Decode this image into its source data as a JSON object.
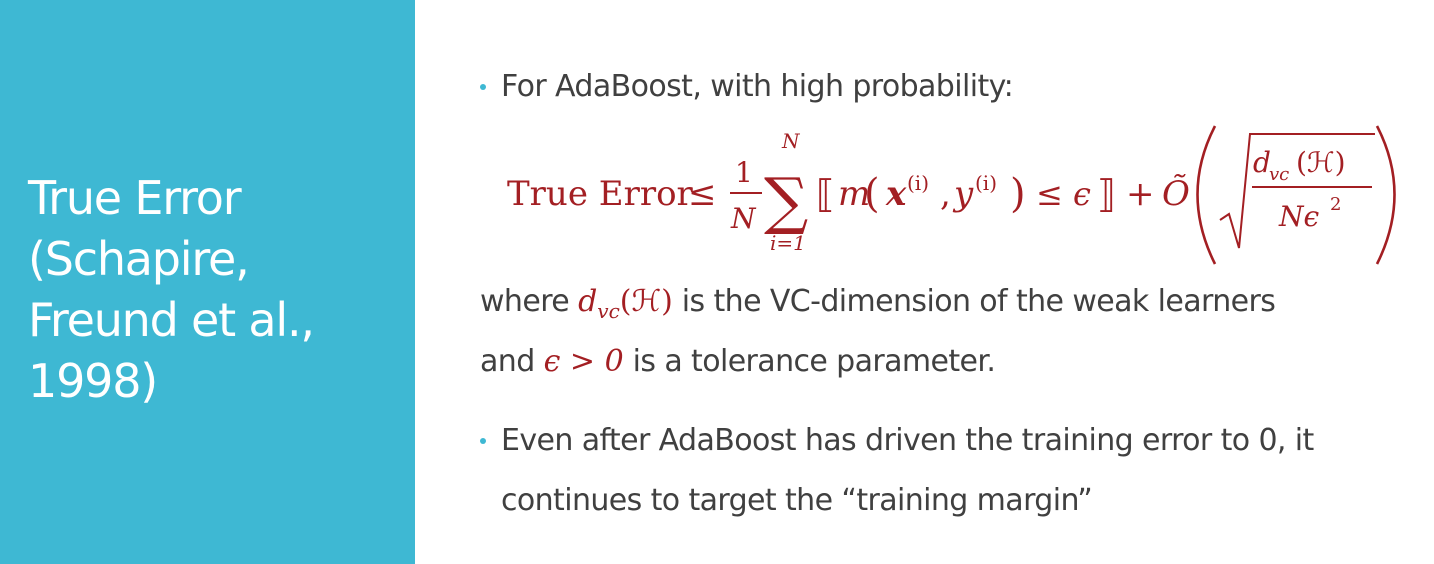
{
  "title": {
    "line1": "True Error",
    "line2": "(Schapire,",
    "line3": "Freund et al.,",
    "line4": "1998)"
  },
  "bullets": [
    {
      "text": "For AdaBoost, with high probability:"
    },
    {
      "line1": "Even after AdaBoost has driven the training error to 0, it",
      "line2": "continues to target the “training margin”"
    }
  ],
  "formula": {
    "lhs": "True Error",
    "leq": "≤",
    "frac_num": "1",
    "frac_den": "N",
    "sum_sign": "∑",
    "sum_upper": "N",
    "sum_lower": "i=1",
    "bracket_open": "⟦",
    "m": "m",
    "x_bold": "x",
    "sup_i": "(i)",
    "y": "y",
    "comparison": "≤ ϵ",
    "bracket_close": "⟧",
    "plus": "+",
    "o_tilde": "Õ",
    "root_num": "d",
    "root_num_sub": "vc",
    "root_num_arg": "(ℋ)",
    "root_den": "Nϵ",
    "root_den_sup": "2"
  },
  "explanation": {
    "line1_pre": "where ",
    "dvc": "d",
    "dvc_sub": "vc",
    "dvc_arg": "(ℋ)",
    "line1_post": " is the VC-dimension of the weak learners",
    "line2_pre": "and ",
    "epsilon_cond": "ϵ > 0",
    "line2_post": " is a tolerance parameter."
  },
  "colors": {
    "panel": "#3eb8d3",
    "math": "#a31f23",
    "text": "#404040"
  }
}
